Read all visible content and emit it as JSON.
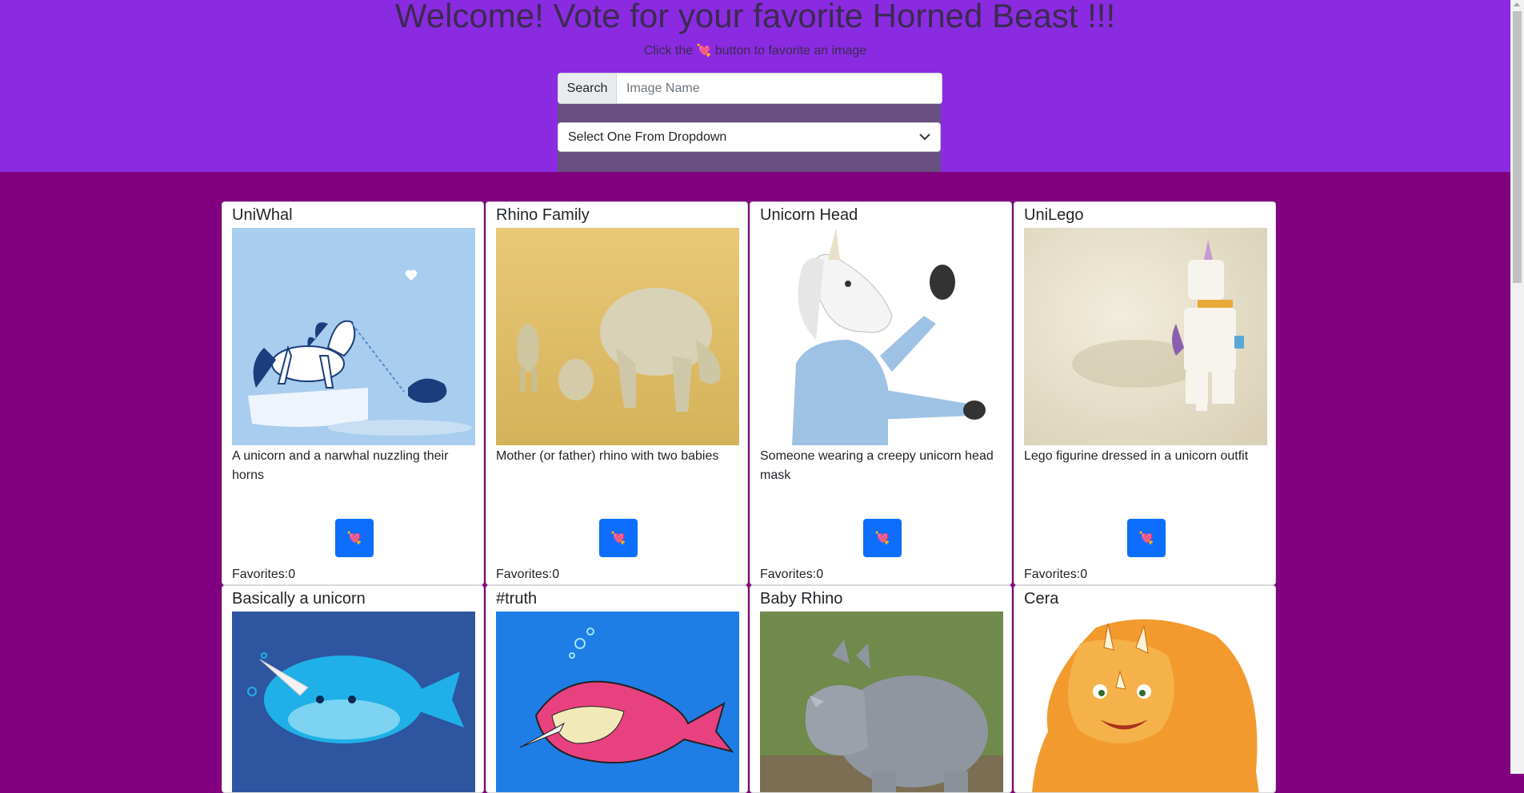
{
  "header": {
    "title": "Welcome! Vote for your favorite Horned Beast !!!",
    "subtitle_pre": "Click the",
    "subtitle_heart": "💘",
    "subtitle_post": "button to favorite an image"
  },
  "search": {
    "label": "Search",
    "placeholder": "Image Name",
    "value": ""
  },
  "dropdown": {
    "selected": "Select One From Dropdown"
  },
  "favorite_button_glyph": "💘",
  "favorites_prefix": "Favorites:",
  "cards": [
    {
      "title": "UniWhal",
      "description": "A unicorn and a narwhal nuzzling their horns",
      "favorites": "Favorites:0"
    },
    {
      "title": "Rhino Family",
      "description": "Mother (or father) rhino with two babies",
      "favorites": "Favorites:0"
    },
    {
      "title": "Unicorn Head",
      "description": "Someone wearing a creepy unicorn head mask",
      "favorites": "Favorites:0"
    },
    {
      "title": "UniLego",
      "description": "Lego figurine dressed in a unicorn outfit",
      "favorites": "Favorites:0"
    },
    {
      "title": "Basically a unicorn",
      "description": "",
      "favorites": ""
    },
    {
      "title": "#truth",
      "description": "",
      "favorites": ""
    },
    {
      "title": "Baby Rhino",
      "description": "",
      "favorites": ""
    },
    {
      "title": "Cera",
      "description": "",
      "favorites": ""
    }
  ],
  "colors": {
    "header_bg": "#8a2be2",
    "page_bg": "#800080",
    "button_bg": "#0d6efd",
    "heart": "#e8315b"
  }
}
